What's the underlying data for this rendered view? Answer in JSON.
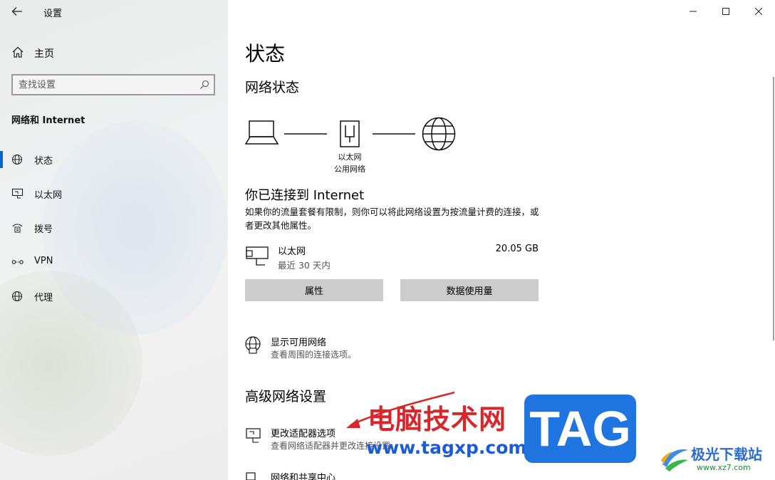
{
  "window": {
    "title": "设置",
    "controls": {
      "minimize": "minimize",
      "maximize": "maximize",
      "close": "close"
    }
  },
  "sidebar": {
    "home_label": "主页",
    "search_placeholder": "查找设置",
    "section_title": "网络和 Internet",
    "items": [
      {
        "label": "状态",
        "icon": "globe-icon",
        "active": true
      },
      {
        "label": "以太网",
        "icon": "ethernet-icon",
        "active": false
      },
      {
        "label": "拨号",
        "icon": "dialup-icon",
        "active": false
      },
      {
        "label": "VPN",
        "icon": "vpn-icon",
        "active": false
      },
      {
        "label": "代理",
        "icon": "globe-proxy-icon",
        "active": false
      }
    ]
  },
  "main": {
    "page_title": "状态",
    "network_status_heading": "网络状态",
    "diagram": {
      "adapter_name": "以太网",
      "network_type": "公用网络"
    },
    "connected_heading": "你已连接到 Internet",
    "connected_desc": "如果你的流量套餐有限制，则你可以将此网络设置为按流量计费的连接，或者更改其他属性。",
    "adapter": {
      "name": "以太网",
      "period": "最近 30 天内",
      "usage": "20.05 GB"
    },
    "buttons": {
      "properties": "属性",
      "data_usage": "数据使用量"
    },
    "show_networks": {
      "title": "显示可用网络",
      "desc": "查看周围的连接选项。"
    },
    "advanced_heading": "高级网络设置",
    "change_adapter": {
      "title": "更改适配器选项",
      "desc": "查看网络适配器并更改连接设置。"
    },
    "sharing_center": {
      "title": "网络和共享中心"
    }
  },
  "watermark": {
    "site_name": "电脑技术网",
    "url": "www.tagxp.com",
    "tag": "TAG",
    "logo_text": "极光下载站",
    "logo_url": "www.xz7.com"
  },
  "colors": {
    "accent": "#0a64c8",
    "button_bg": "#cccccc",
    "watermark_red": "#d8262a",
    "watermark_blue": "#1f74e0"
  }
}
